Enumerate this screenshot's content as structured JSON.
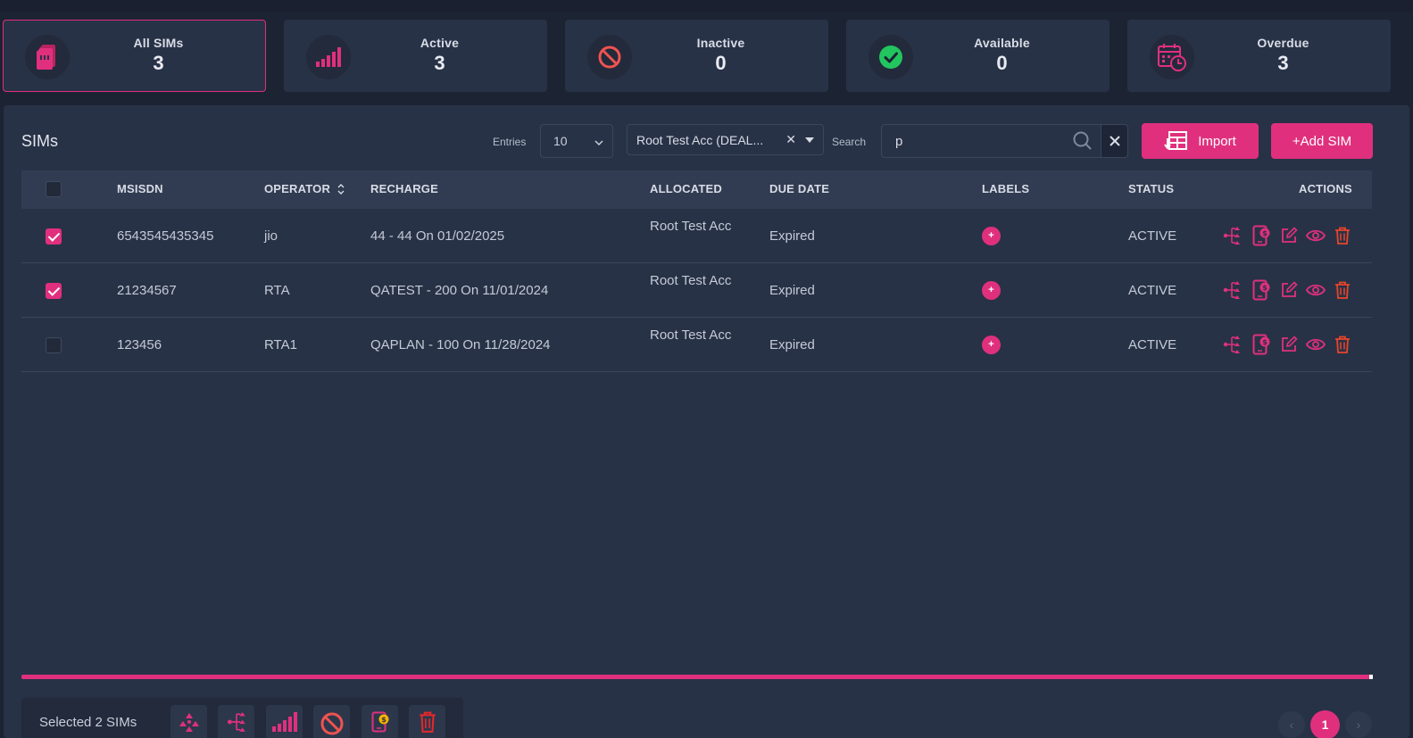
{
  "stats": [
    {
      "label": "All SIMs",
      "value": "3",
      "icon": "sim-card-icon",
      "color": "#e0307d"
    },
    {
      "label": "Active",
      "value": "3",
      "icon": "signal-bars-icon",
      "color": "#e0307d"
    },
    {
      "label": "Inactive",
      "value": "0",
      "icon": "ban-icon",
      "color": "#ef5350"
    },
    {
      "label": "Available",
      "value": "0",
      "icon": "check-circle-icon",
      "color": "#22c55e"
    },
    {
      "label": "Overdue",
      "value": "3",
      "icon": "calendar-clock-icon",
      "color": "#e0307d"
    }
  ],
  "panel": {
    "title": "SIMs",
    "entries_label": "Entries",
    "entries_value": "10",
    "account_filter": "Root Test Acc (DEAL...",
    "search_label": "Search",
    "search_value": "p",
    "import_label": "Import",
    "add_label": "+Add SIM"
  },
  "table": {
    "columns": [
      "MSISDN",
      "OPERATOR",
      "RECHARGE",
      "ALLOCATED",
      "DUE DATE",
      "LABELS",
      "STATUS",
      "ACTIONS"
    ],
    "rows": [
      {
        "checked": true,
        "msisdn": "6543545435345",
        "operator": "jio",
        "recharge": "44 - 44 On 01/02/2025",
        "allocated": "Root Test Acc",
        "due": "Expired",
        "label_add": "+",
        "status": "ACTIVE"
      },
      {
        "checked": true,
        "msisdn": "21234567",
        "operator": "RTA",
        "recharge": "QATEST - 200 On 11/01/2024",
        "allocated": "Root Test Acc",
        "due": "Expired",
        "label_add": "+",
        "status": "ACTIVE"
      },
      {
        "checked": false,
        "msisdn": "123456",
        "operator": "RTA1",
        "recharge": "QAPLAN - 100 On 11/28/2024",
        "allocated": "Root Test Acc",
        "due": "Expired",
        "label_add": "+",
        "status": "ACTIVE"
      }
    ]
  },
  "bulk": {
    "selected_text": "Selected 2 SIMs"
  },
  "pagination": {
    "prev": "‹",
    "current": "1",
    "next": "›"
  },
  "colors": {
    "accent": "#e0307d",
    "danger": "#ef5350",
    "success": "#22c55e",
    "panel": "#283247",
    "background": "#1c2333"
  }
}
